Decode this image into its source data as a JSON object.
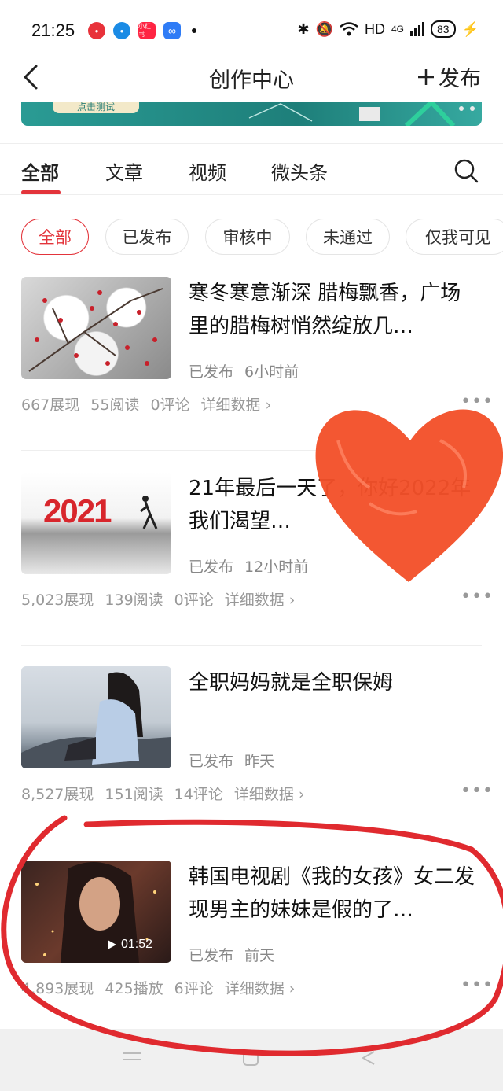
{
  "status_bar": {
    "time": "21:25",
    "app_icon_label": "小红书",
    "network": "HD",
    "signal": "4G",
    "battery": "83"
  },
  "header": {
    "title": "创作中心",
    "publish_label": "发布"
  },
  "banner": {
    "pill_text": "点击测试"
  },
  "tabs": [
    {
      "label": "全部"
    },
    {
      "label": "文章"
    },
    {
      "label": "视频"
    },
    {
      "label": "微头条"
    }
  ],
  "filters": [
    {
      "label": "全部"
    },
    {
      "label": "已发布"
    },
    {
      "label": "审核中"
    },
    {
      "label": "未通过"
    },
    {
      "label": "仅我可见"
    }
  ],
  "cards": [
    {
      "title": "寒冬寒意渐深 腊梅飘香，广场里的腊梅树悄然绽放几…",
      "status": "已发布",
      "time": "6小时前",
      "stats": [
        "667展现",
        "55阅读",
        "0评论"
      ],
      "detail": "详细数据 ›"
    },
    {
      "title": "21年最后一天了，你好2022年我们渴望…",
      "image_text": "2021",
      "status": "已发布",
      "time": "12小时前",
      "stats": [
        "5,023展现",
        "139阅读",
        "0评论"
      ],
      "detail": "详细数据 ›"
    },
    {
      "title": "全职妈妈就是全职保姆",
      "status": "已发布",
      "time": "昨天",
      "stats": [
        "8,527展现",
        "151阅读",
        "14评论"
      ],
      "detail": "详细数据 ›"
    },
    {
      "title": "韩国电视剧《我的女孩》女二发现男主的妹妹是假的了…",
      "duration": "01:52",
      "status": "已发布",
      "time": "前天",
      "stats": [
        "4,893展现",
        "425播放",
        "6评论"
      ],
      "detail": "详细数据 ›"
    }
  ],
  "colors": {
    "accent": "#e3343b",
    "heart": "#f2502a",
    "scribble": "#e02a2f"
  }
}
